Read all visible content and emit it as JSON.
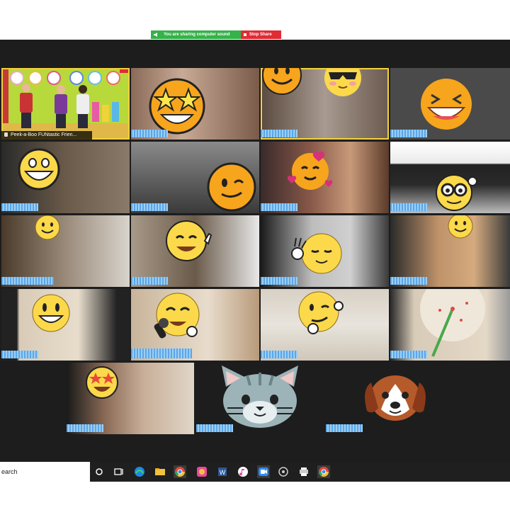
{
  "share_banner": {
    "message": "You are sharing computer sound",
    "stop_label": "Stop Share",
    "colors": {
      "message_bg": "#35b24a",
      "stop_bg": "#e02c35"
    }
  },
  "gallery": {
    "featured_label": "Peek-a-Boo FUNtastic Frien...",
    "tile_count": 23,
    "name_tags_pixelated": true,
    "active_speaker_color": "#f2d23b",
    "avatar_icons": [
      "star-eyes-emoji-icon",
      "smiley-emoji-icon",
      "sunglasses-emoji-icon",
      "laughing-emoji-icon",
      "grin-emoji-icon",
      "wink-emoji-icon",
      "heart-face-emoji-icon",
      "nerd-glasses-emoji-icon",
      "small-smiley-emoji-icon",
      "waving-emoji-icon",
      "ok-hand-emoji-icon",
      "tiny-smiley-emoji-icon",
      "big-grin-emoji-icon",
      "singing-emoji-icon",
      "thinking-wink-emoji-icon",
      "star-eyes-emoji-icon",
      "cat-face-icon",
      "dog-face-icon"
    ]
  },
  "taskbar": {
    "search_text": "earch",
    "icons": [
      "task-view-icon",
      "multitask-icon",
      "edge-icon",
      "file-explorer-icon",
      "chrome-icon",
      "photos-icon",
      "word-icon",
      "itunes-icon",
      "zoom-icon",
      "app-icon",
      "printer-icon",
      "chrome-icon"
    ],
    "active_icon": "zoom-icon"
  }
}
